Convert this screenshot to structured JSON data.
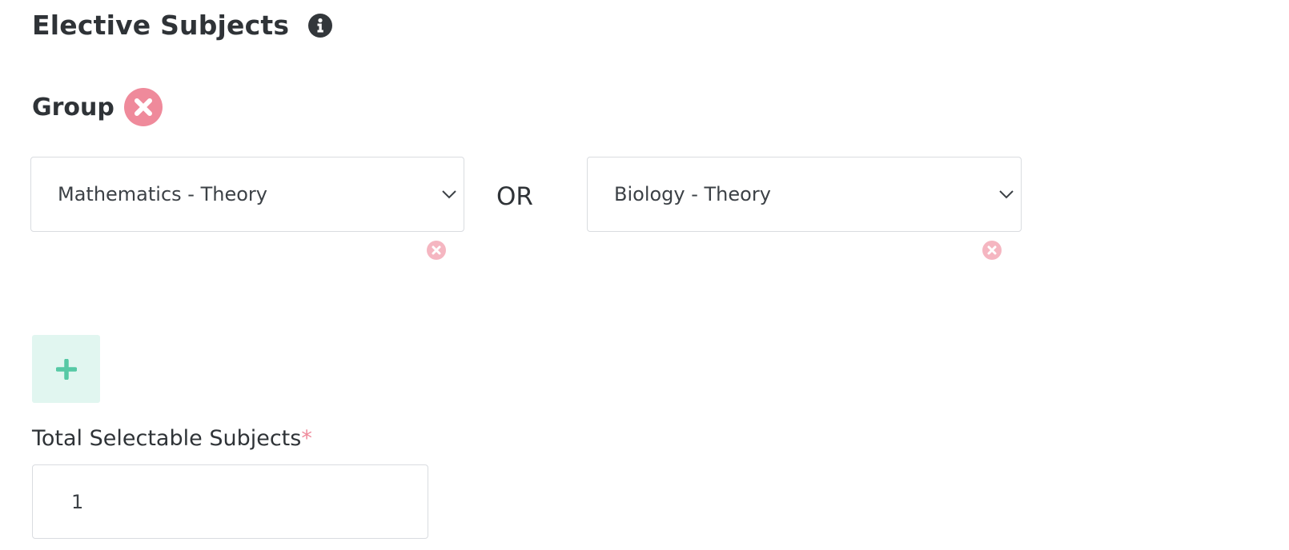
{
  "section": {
    "title": "Elective Subjects",
    "info_icon": "info-circle-icon"
  },
  "group": {
    "label": "Group",
    "remove_icon": "close-circle-icon",
    "remove_color": "#ef8a9b",
    "subjects": [
      {
        "selected": "Mathematics - Theory"
      },
      {
        "selected": "Biology - Theory"
      }
    ],
    "separator": "OR"
  },
  "add_button": {
    "icon": "plus-icon",
    "accent": "#56c9a5"
  },
  "total_selectable": {
    "label": "Total Selectable Subjects",
    "required_mark": "*",
    "value": "1"
  }
}
